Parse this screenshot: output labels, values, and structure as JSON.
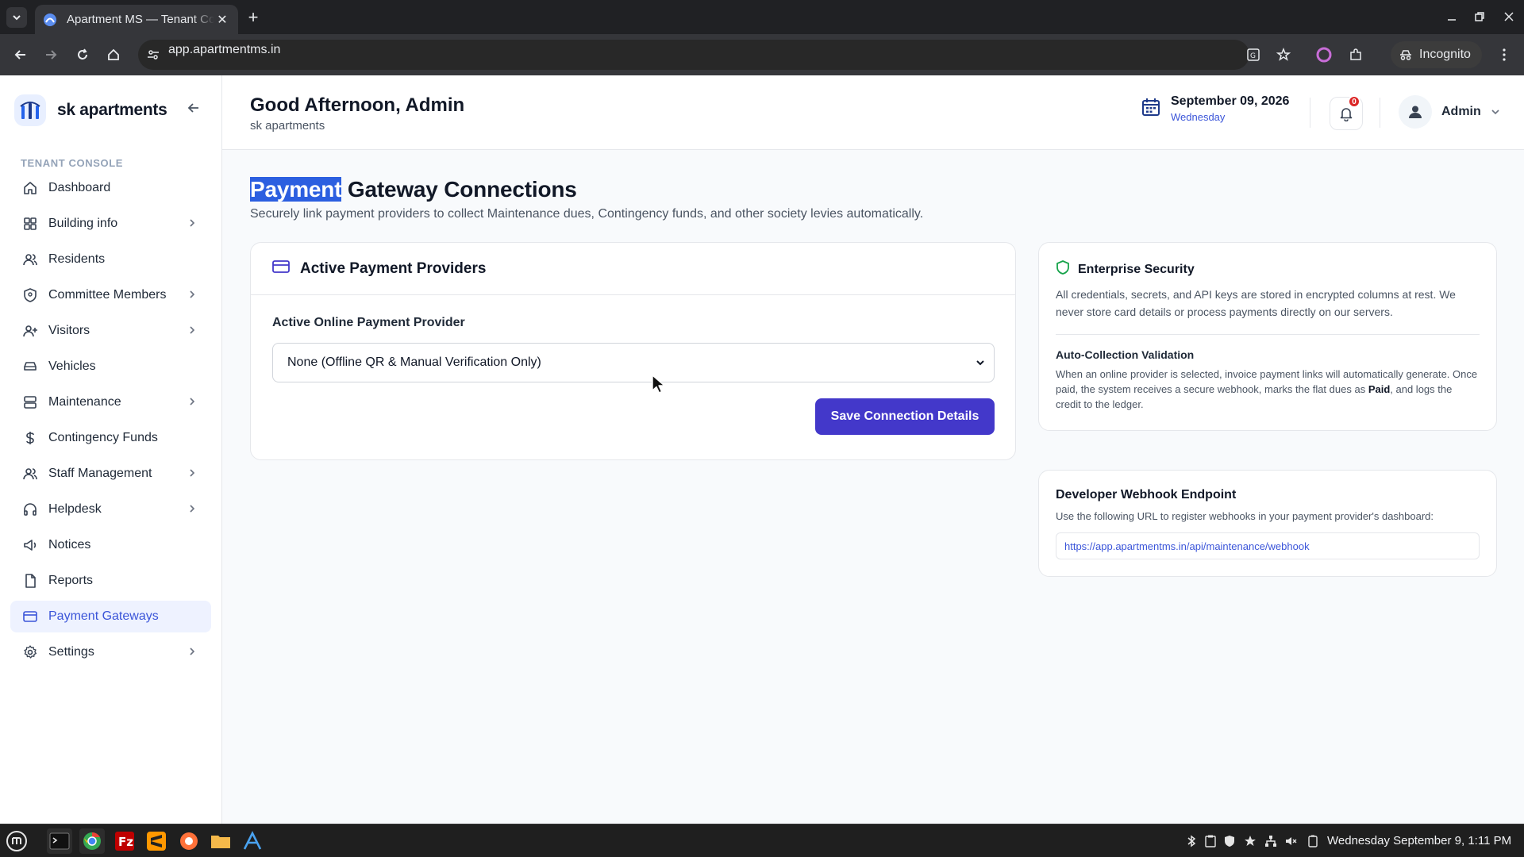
{
  "browser": {
    "tab_title": "Apartment MS — Tenant Console",
    "url": "app.apartmentms.in",
    "incognito_label": "Incognito"
  },
  "sidebar": {
    "brand": "sk apartments",
    "section_label": "TENANT CONSOLE",
    "items": [
      {
        "label": "Dashboard",
        "icon": "home-icon"
      },
      {
        "label": "Building info",
        "icon": "grid-icon"
      },
      {
        "label": "Residents",
        "icon": "users-icon"
      },
      {
        "label": "Committee Members",
        "icon": "shield-icon"
      },
      {
        "label": "Visitors",
        "icon": "user-plus-icon"
      },
      {
        "label": "Vehicles",
        "icon": "car-icon"
      },
      {
        "label": "Maintenance",
        "icon": "server-icon"
      },
      {
        "label": "Contingency Funds",
        "icon": "dollar-icon"
      },
      {
        "label": "Staff Management",
        "icon": "users-icon"
      },
      {
        "label": "Helpdesk",
        "icon": "headphones-icon"
      },
      {
        "label": "Notices",
        "icon": "megaphone-icon"
      },
      {
        "label": "Reports",
        "icon": "file-icon"
      },
      {
        "label": "Payment Gateways",
        "icon": "credit-card-icon"
      },
      {
        "label": "Settings",
        "icon": "gear-icon"
      }
    ]
  },
  "header": {
    "greeting": "Good Afternoon, Admin",
    "subtitle": "sk apartments",
    "date": "September 09, 2026",
    "weekday": "Wednesday",
    "notification_count": "0",
    "user_name": "Admin"
  },
  "page": {
    "title_highlight": "Payment",
    "title_rest": " Gateway Connections",
    "description": "Securely link payment providers to collect Maintenance dues, Contingency funds, and other society levies automatically."
  },
  "providers_card": {
    "title": "Active Payment Providers",
    "field_label": "Active Online Payment Provider",
    "selected_option": "None (Offline QR & Manual Verification Only)",
    "save_label": "Save Connection Details"
  },
  "security_card": {
    "title": "Enterprise Security",
    "text": "All credentials, secrets, and API keys are stored in encrypted columns at rest. We never store card details or process payments directly on our servers.",
    "sub_title": "Auto-Collection Validation",
    "sub_text_1": "When an online provider is selected, invoice payment links will automatically generate. Once paid, the system receives a secure webhook, marks the flat dues as ",
    "sub_text_bold": "Paid",
    "sub_text_2": ", and logs the credit to the ledger."
  },
  "webhook_card": {
    "title": "Developer Webhook Endpoint",
    "text": "Use the following URL to register webhooks in your payment provider's dashboard:",
    "url": "https://app.apartmentms.in/api/maintenance/webhook"
  },
  "taskbar": {
    "clock": "Wednesday September 9, 1:11 PM"
  },
  "colors": {
    "accent": "#4338ca",
    "active_nav": "#3b55d9",
    "selection": "#2c5fe0",
    "security_green": "#16a34a"
  }
}
